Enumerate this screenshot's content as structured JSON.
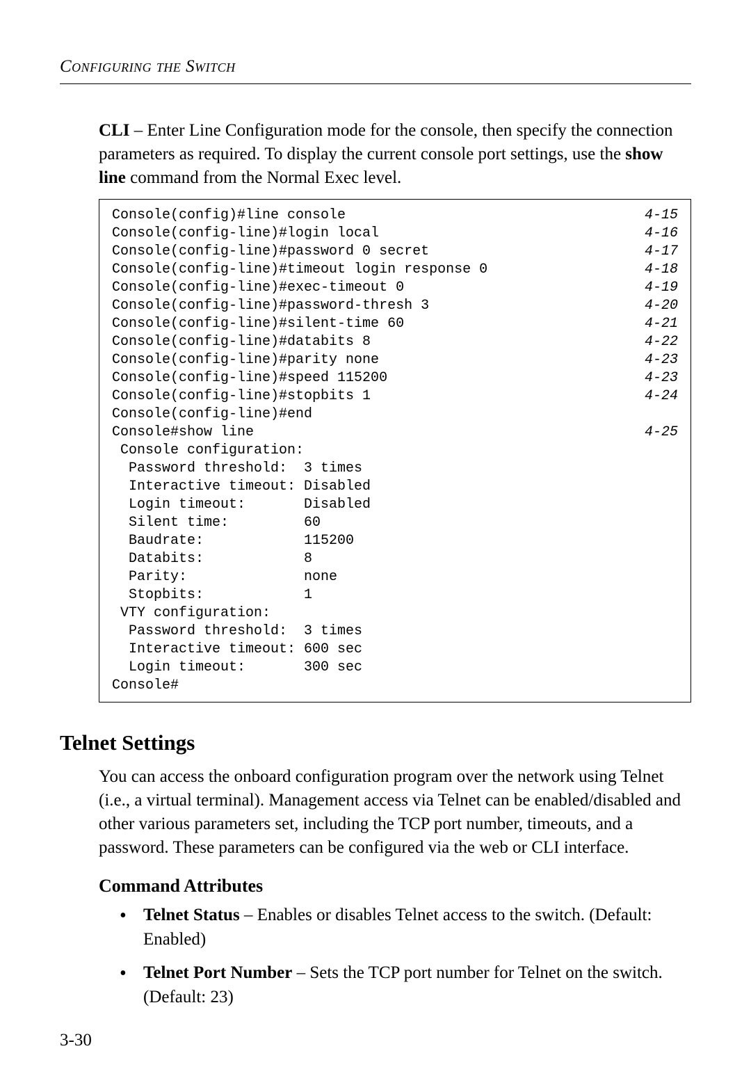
{
  "header": {
    "running_head": "Configuring the Switch"
  },
  "intro": {
    "cli_label": "CLI",
    "text_before": " – Enter Line Configuration mode for the console, then specify the connection parameters as required. To display the current console port settings, use the ",
    "show_line": "show line",
    "text_after": " command from the Normal Exec level."
  },
  "cli": {
    "lines": [
      {
        "cmd": "Console(config)#line console",
        "ref": "4-15"
      },
      {
        "cmd": "Console(config-line)#login local",
        "ref": "4-16"
      },
      {
        "cmd": "Console(config-line)#password 0 secret",
        "ref": "4-17"
      },
      {
        "cmd": "Console(config-line)#timeout login response 0",
        "ref": "4-18"
      },
      {
        "cmd": "Console(config-line)#exec-timeout 0",
        "ref": "4-19"
      },
      {
        "cmd": "Console(config-line)#password-thresh 3",
        "ref": "4-20"
      },
      {
        "cmd": "Console(config-line)#silent-time 60",
        "ref": "4-21"
      },
      {
        "cmd": "Console(config-line)#databits 8",
        "ref": "4-22"
      },
      {
        "cmd": "Console(config-line)#parity none",
        "ref": "4-23"
      },
      {
        "cmd": "Console(config-line)#speed 115200",
        "ref": "4-23"
      },
      {
        "cmd": "Console(config-line)#stopbits 1",
        "ref": "4-24"
      },
      {
        "cmd": "Console(config-line)#end",
        "ref": ""
      },
      {
        "cmd": "Console#show line",
        "ref": "4-25"
      },
      {
        "cmd": " Console configuration:",
        "ref": ""
      },
      {
        "cmd": "  Password threshold:  3 times",
        "ref": ""
      },
      {
        "cmd": "  Interactive timeout: Disabled",
        "ref": ""
      },
      {
        "cmd": "  Login timeout:       Disabled",
        "ref": ""
      },
      {
        "cmd": "  Silent time:         60",
        "ref": ""
      },
      {
        "cmd": "  Baudrate:            115200",
        "ref": ""
      },
      {
        "cmd": "  Databits:            8",
        "ref": ""
      },
      {
        "cmd": "  Parity:              none",
        "ref": ""
      },
      {
        "cmd": "  Stopbits:            1",
        "ref": ""
      },
      {
        "cmd": "",
        "ref": ""
      },
      {
        "cmd": " VTY configuration:",
        "ref": ""
      },
      {
        "cmd": "  Password threshold:  3 times",
        "ref": ""
      },
      {
        "cmd": "  Interactive timeout: 600 sec",
        "ref": ""
      },
      {
        "cmd": "  Login timeout:       300 sec",
        "ref": ""
      },
      {
        "cmd": "Console#",
        "ref": ""
      }
    ]
  },
  "telnet": {
    "heading": "Telnet Settings",
    "para": "You can access the onboard configuration program over the network using Telnet (i.e., a virtual terminal). Management access via Telnet can be enabled/disabled and other various parameters set, including the TCP port number, timeouts, and a password. These parameters can be configured via the web or CLI interface.",
    "subheading": "Command Attributes",
    "bullets": [
      {
        "label": "Telnet Status",
        "desc": " – Enables or disables Telnet access to the switch. (Default: Enabled)"
      },
      {
        "label": "Telnet Port Number",
        "desc": " – Sets the TCP port number for Telnet on the switch. (Default: 23)"
      }
    ]
  },
  "page_number": "3-30"
}
